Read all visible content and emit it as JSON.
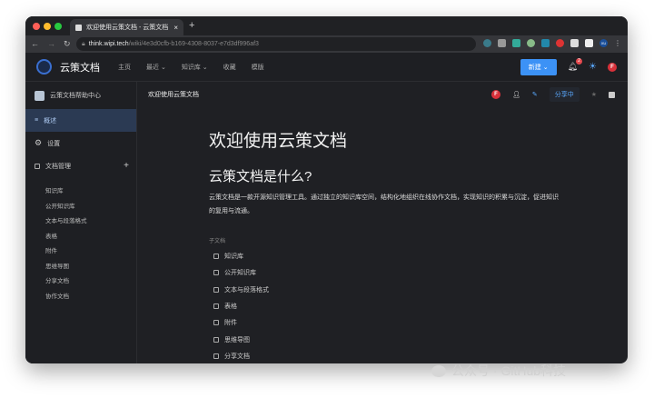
{
  "browser": {
    "tab_title": "欢迎使用云策文档 - 云策文档",
    "url_host": "think.wipi.tech",
    "url_path": "/wiki/4e3d0cfb-b169-4308-8037-e7d3df996af3",
    "ext_badge": "XU"
  },
  "header": {
    "brand": "云策文档",
    "menu": [
      "主页",
      "最近",
      "知识库",
      "收藏",
      "模版"
    ],
    "new_button": "新建",
    "notify_count": "2",
    "avatar": "F"
  },
  "sidebar": {
    "space_name": "云策文档帮助中心",
    "items": [
      {
        "label": "概述"
      },
      {
        "label": "设置"
      },
      {
        "label": "文档管理"
      }
    ],
    "docs": [
      "知识库",
      "公开知识库",
      "文本与段落格式",
      "表格",
      "附件",
      "思维导图",
      "分享文档",
      "协作文档"
    ]
  },
  "doc_header": {
    "title": "欢迎使用云策文档",
    "avatar": "F",
    "share": "分享中"
  },
  "doc": {
    "title": "欢迎使用云策文档",
    "h2": "云策文档是什么?",
    "body": "云策文档是一款开源知识管理工具。通过独立的知识库空间，结构化地组织在线协作文档，实现知识的积累与沉淀，促进知识的复用与流通。",
    "children_label": "子文档",
    "children": [
      "知识库",
      "公开知识库",
      "文本与段落格式",
      "表格",
      "附件",
      "思维导图",
      "分享文档"
    ]
  },
  "watermark": "公众号 · GitHub科技"
}
